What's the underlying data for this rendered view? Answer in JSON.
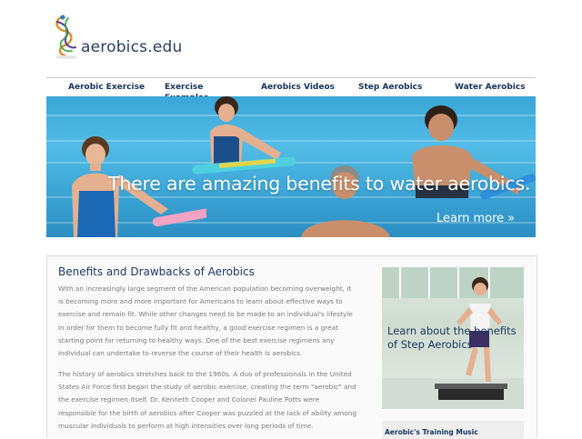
{
  "site": {
    "logo_text": "aerobics.edu"
  },
  "nav": {
    "items": [
      {
        "label": "Aerobic Exercise"
      },
      {
        "label": "Exercise Examples"
      },
      {
        "label": "Aerobics Videos"
      },
      {
        "label": "Step Aerobics"
      },
      {
        "label": "Water Aerobics"
      }
    ]
  },
  "hero": {
    "headline": "There are amazing benefits to water aerobics.",
    "cta": "Learn more »"
  },
  "article": {
    "title": "Benefits and Drawbacks of Aerobics",
    "paragraphs": [
      "With an increasingly large segment of the American population becoming overweight, it is becoming more and more important for Americans to learn about effective ways to exercise and remain fit. While other changes need to be made to an individual's lifestyle in order for them to become fully fit and healthy, a good exercise regimen is a great starting point for returning to healthy ways. One of the best exercise regimens any individual can undertake to reverse the course of their health is aerobics.",
      "The history of aerobics stretches back to the 1960s. A duo of professionals in the United States Air Force first began the study of aerobic exercise, creating the term \"aerobic\" and the exercise regimen itself. Dr. Kenneth Cooper and Colonel Pauline Potts were responsible for the birth of aerobics after Cooper was puzzled at the lack of ability among muscular individuals to perform at high intensities over long periods of time."
    ]
  },
  "sidebar": {
    "promo_text": "Learn about the benefits of Step Aerobics",
    "box_title": "Aerobic's Training Music"
  },
  "colors": {
    "nav_text": "#14335a",
    "title": "#1d3a66",
    "body_text": "#7b7b7b",
    "water": "#3aa6d6"
  }
}
